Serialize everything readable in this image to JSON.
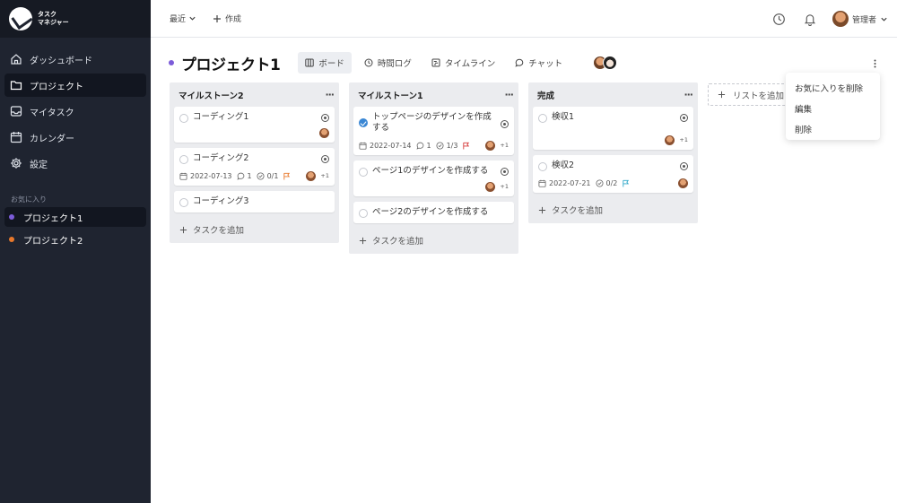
{
  "app": {
    "logo_line1": "タスク",
    "logo_line2": "マネジャー"
  },
  "sidebar": {
    "nav": [
      {
        "label": "ダッシュボード",
        "icon": "home-icon"
      },
      {
        "label": "プロジェクト",
        "icon": "folder-icon",
        "active": true
      },
      {
        "label": "マイタスク",
        "icon": "inbox-icon"
      },
      {
        "label": "カレンダー",
        "icon": "calendar-icon"
      },
      {
        "label": "設定",
        "icon": "gear-icon"
      }
    ],
    "favorites_heading": "お気に入り",
    "favorites": [
      {
        "label": "プロジェクト1",
        "color": "#7c5cd9",
        "active": true
      },
      {
        "label": "プロジェクト2",
        "color": "#e8782b"
      }
    ]
  },
  "topbar": {
    "recent_label": "最近",
    "create_label": "作成",
    "user_name": "管理者"
  },
  "project": {
    "title": "プロジェクト1",
    "dot_color": "#7c5cd9",
    "tabs": [
      {
        "label": "ボード",
        "icon": "board-icon",
        "active": true
      },
      {
        "label": "時間ログ",
        "icon": "clock-icon"
      },
      {
        "label": "タイムライン",
        "icon": "timeline-icon"
      },
      {
        "label": "チャット",
        "icon": "chat-icon"
      }
    ]
  },
  "lists": [
    {
      "title": "マイルストーン2",
      "cards": [
        {
          "title": "コーディング1",
          "done": false,
          "has_target": true,
          "meta": null,
          "assignee_extra": ""
        },
        {
          "title": "コーディング2",
          "done": false,
          "has_target": true,
          "meta": {
            "date": "2022-07-13",
            "comments": "1",
            "checklist": "0/1",
            "flag_color": "#e8782b"
          },
          "assignee_extra": "+1"
        },
        {
          "title": "コーディング3",
          "done": false,
          "has_target": false,
          "meta": null,
          "assignee_extra": null
        }
      ],
      "add_label": "タスクを追加"
    },
    {
      "title": "マイルストーン1",
      "cards": [
        {
          "title": "トップページのデザインを作成する",
          "done": true,
          "has_target": true,
          "meta": {
            "date": "2022-07-14",
            "comments": "1",
            "checklist": "1/3",
            "flag_color": "#d63a3a"
          },
          "assignee_extra": "+1"
        },
        {
          "title": "ページ1のデザインを作成する",
          "done": false,
          "has_target": true,
          "meta": null,
          "assignee_extra": "+1"
        },
        {
          "title": "ページ2のデザインを作成する",
          "done": false,
          "has_target": false,
          "meta": null,
          "assignee_extra": null
        }
      ],
      "add_label": "タスクを追加"
    },
    {
      "title": "完成",
      "cards": [
        {
          "title": "検収1",
          "done": false,
          "has_target": true,
          "meta": null,
          "assignee_extra": "+1"
        },
        {
          "title": "検収2",
          "done": false,
          "has_target": true,
          "meta": {
            "date": "2022-07-21",
            "comments": null,
            "checklist": "0/2",
            "flag_color": "#2fa8c9"
          },
          "assignee_extra": ""
        }
      ],
      "add_label": "タスクを追加"
    }
  ],
  "add_list_label": "リストを追加",
  "dropdown": {
    "items": [
      "お気に入りを削除",
      "編集",
      "削除"
    ]
  }
}
